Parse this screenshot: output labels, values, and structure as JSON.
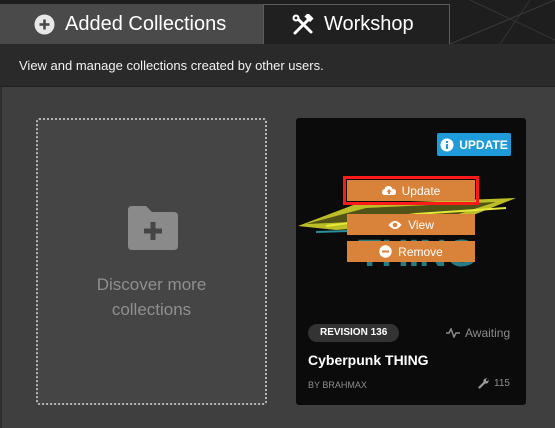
{
  "tabs": {
    "added": {
      "label": "Added Collections",
      "icon": "plus-circle-icon"
    },
    "workshop": {
      "label": "Workshop",
      "icon": "tools-icon"
    }
  },
  "description": "View and manage collections created by other users.",
  "discover": {
    "label": "Discover more\ncollections",
    "icon": "folder-plus-icon"
  },
  "collection": {
    "update_badge": "UPDATE",
    "actions": {
      "update": "Update",
      "view": "View",
      "remove": "Remove"
    },
    "revision": "REVISION 136",
    "status": "Awaiting",
    "title": "Cyberpunk THING",
    "author": "BY BRAHMAX",
    "count": "115"
  },
  "colors": {
    "accent_orange": "#d9823a",
    "badge_blue": "#1f9bd9",
    "highlight_red": "#ff1a1a"
  }
}
